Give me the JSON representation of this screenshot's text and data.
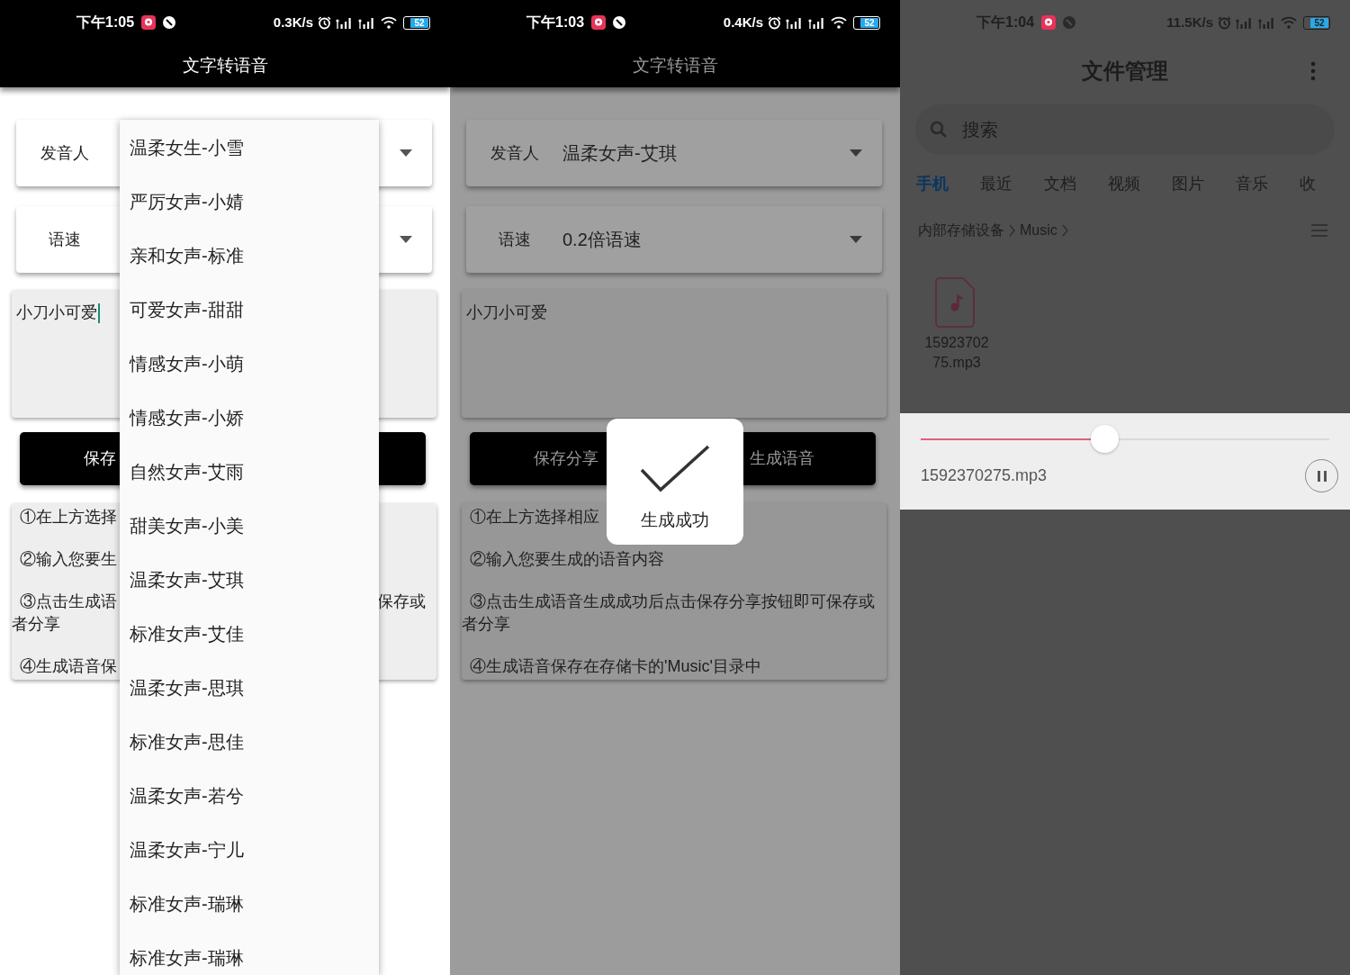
{
  "screens": [
    {
      "kind": "tts",
      "dimmed": false,
      "status_bar": {
        "time": "下午1:05",
        "net_speed": "0.3K/s",
        "battery": "52"
      },
      "title": "文字转语音",
      "spinners": [
        {
          "label": "发音人"
        },
        {
          "label": "语速"
        }
      ],
      "text_input": {
        "value": "小刀小可爱",
        "focused": true
      },
      "buttons": [
        {
          "label": "保存"
        }
      ],
      "instructions": [
        {
          "text": "①在上方选择"
        },
        {
          "text": "②输入您要生"
        },
        {
          "text": "③点击生成语",
          "right": "保存或",
          "second_line": "者分享"
        },
        {
          "text": "④生成语音保"
        }
      ],
      "dropdown": {
        "items": [
          "温柔女生-小雪",
          "严厉女声-小婧",
          "亲和女声-标准",
          "可爱女声-甜甜",
          "情感女声-小萌",
          "情感女声-小娇",
          "自然女声-艾雨",
          "甜美女声-小美",
          "温柔女声-艾琪",
          "标准女声-艾佳",
          "温柔女声-思琪",
          "标准女声-思佳",
          "温柔女声-若兮",
          "温柔女声-宁儿",
          "标准女声-瑞琳",
          "标准女声-瑞琳"
        ]
      }
    },
    {
      "kind": "tts",
      "dimmed": true,
      "status_bar": {
        "time": "下午1:03",
        "net_speed": "0.4K/s",
        "battery": "52"
      },
      "title": "文字转语音",
      "spinners": [
        {
          "label": "发音人",
          "value": "温柔女声-艾琪"
        },
        {
          "label": "语速",
          "value": "0.2倍语速"
        }
      ],
      "text_input": {
        "value": "小刀小可爱",
        "focused": false
      },
      "buttons": [
        {
          "label": "保存分享"
        },
        {
          "label": "生成语音"
        }
      ],
      "instructions": [
        {
          "text": "①在上方选择相应"
        },
        {
          "text": "②输入您要生成的语音内容"
        },
        {
          "text": "③点击生成语音生成成功后点击保存分享按钮即可保存或者分享"
        },
        {
          "text": "④生成语音保存在存储卡的'Music'目录中"
        }
      ],
      "toast": {
        "message": "生成成功"
      }
    },
    {
      "kind": "file_manager",
      "dimmed": true,
      "status_bar": {
        "time": "下午1:04",
        "net_speed": "11.5K/s",
        "battery": "52"
      },
      "title": "文件管理",
      "search": {
        "placeholder": "搜索"
      },
      "tabs": [
        {
          "label": "手机",
          "selected": true
        },
        {
          "label": "最近",
          "selected": false
        },
        {
          "label": "文档",
          "selected": false
        },
        {
          "label": "视频",
          "selected": false
        },
        {
          "label": "图片",
          "selected": false
        },
        {
          "label": "音乐",
          "selected": false
        },
        {
          "label": "收",
          "selected": false
        }
      ],
      "breadcrumb": [
        "内部存储设备",
        "Music"
      ],
      "files": [
        {
          "name": "1592370275.mp3"
        }
      ],
      "player": {
        "level": 0.45,
        "file_name": "1592370275.mp3",
        "playing": true
      }
    }
  ]
}
